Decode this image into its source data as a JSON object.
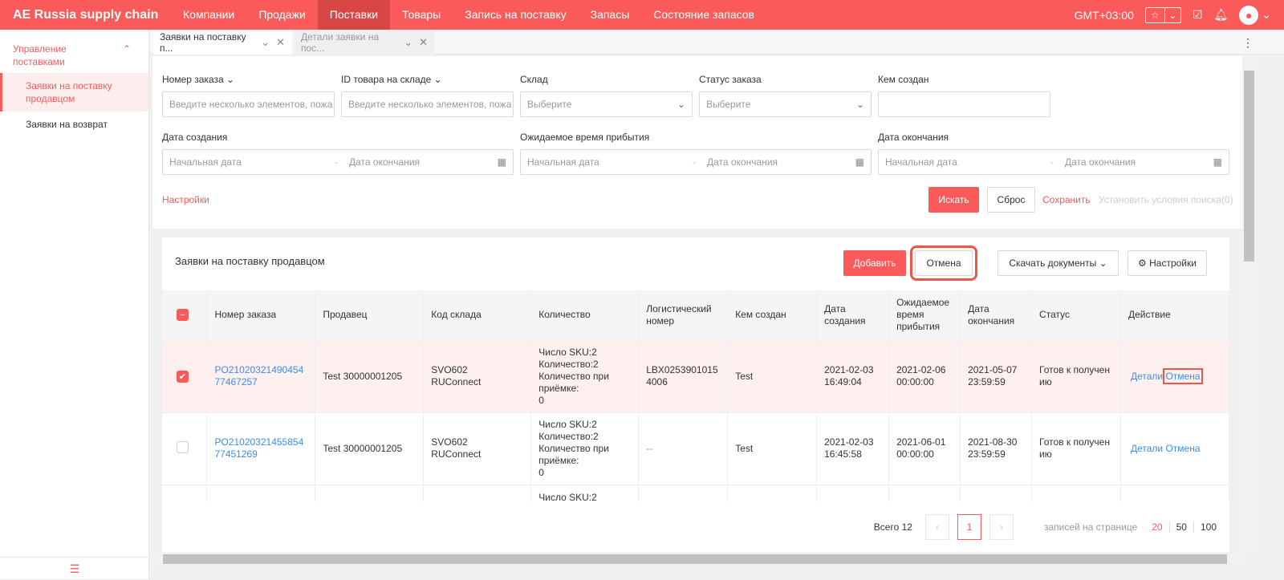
{
  "header": {
    "brand": "AE Russia supply chain",
    "nav": [
      "Компании",
      "Продажи",
      "Поставки",
      "Товары",
      "Запись на поставку",
      "Запасы",
      "Состояние запасов"
    ],
    "active_nav": "Поставки",
    "timezone": "GMT+03:00"
  },
  "sidebar": {
    "group": "Управление поставками",
    "items": [
      "Заявки на поставку продавцом",
      "Заявки на возврат"
    ]
  },
  "tabs": [
    {
      "label": "Заявки на поставку п..."
    },
    {
      "label": "Детали заявки на пос..."
    }
  ],
  "filters": {
    "order_no": {
      "label": "Номер заказа",
      "placeholder": "Введите несколько элементов, пожа"
    },
    "sku_id": {
      "label": "ID товара на складе",
      "placeholder": "Введите несколько элементов, пожа"
    },
    "warehouse": {
      "label": "Склад",
      "placeholder": "Выберите"
    },
    "status": {
      "label": "Статус заказа",
      "placeholder": "Выберите"
    },
    "created_by": {
      "label": "Кем создан",
      "placeholder": ""
    },
    "created_date": {
      "label": "Дата создания",
      "start": "Начальная дата",
      "end": "Дата окончания"
    },
    "eta": {
      "label": "Ожидаемое время прибытия",
      "start": "Начальная дата",
      "end": "Дата окончания"
    },
    "end_date": {
      "label": "Дата окончания",
      "start": "Начальная дата",
      "end": "Дата окончания"
    },
    "settings": "Настройки",
    "search": "Искать",
    "reset": "Сброс",
    "save": "Сохранить",
    "set_conditions": "Установить условия поиска(0)"
  },
  "table_card": {
    "title": "Заявки на поставку продавцом",
    "add": "Добавить",
    "cancel": "Отмена",
    "download": "Скачать документы",
    "settings": "Настройки",
    "columns": [
      "Номер заказа",
      "Продавец",
      "Код склада",
      "Количество",
      "Логистический номер",
      "Кем создан",
      "Дата создания",
      "Ожидаемое время прибытия",
      "Дата окончания",
      "Статус",
      "Действие"
    ],
    "rows": [
      {
        "checked": true,
        "order": "PO2102032149045477467257",
        "seller": "Test 30000001205",
        "wh": "SVO602 RUConnect",
        "qty": [
          "Число SKU:2",
          "Количество:2",
          "Количество при приёмке:",
          "0"
        ],
        "logistic": "LBX02539010154006",
        "creator": "Test",
        "created": "2021-02-03 16:49:04",
        "eta": "2021-02-06 00:00:00",
        "end": "2021-05-07 23:59:59",
        "status": "Готов к получению",
        "actions": [
          "Детали",
          "Отмена"
        ]
      },
      {
        "checked": false,
        "order": "PO2102032145585477451269",
        "seller": "Test 30000001205",
        "wh": "SVO602 RUConnect",
        "qty": [
          "Число SKU:2",
          "Количество:2",
          "Количество при приёмке:",
          "0"
        ],
        "logistic": "--",
        "creator": "Test",
        "created": "2021-02-03 16:45:58",
        "eta": "2021-06-01 00:00:00",
        "end": "2021-08-30 23:59:59",
        "status": "Готов к получению",
        "actions": [
          "Детали",
          "Отмена"
        ]
      },
      {
        "checked": false,
        "qty": [
          "Число SKU:2"
        ]
      }
    ]
  },
  "pagination": {
    "total": "Всего 12",
    "page": "1",
    "per_page_label": "записей на странице",
    "sizes": [
      "20",
      "50",
      "100"
    ],
    "active_size": "20"
  },
  "colors": {
    "brand": "#fa5a5a",
    "link": "#3a8ee6"
  }
}
